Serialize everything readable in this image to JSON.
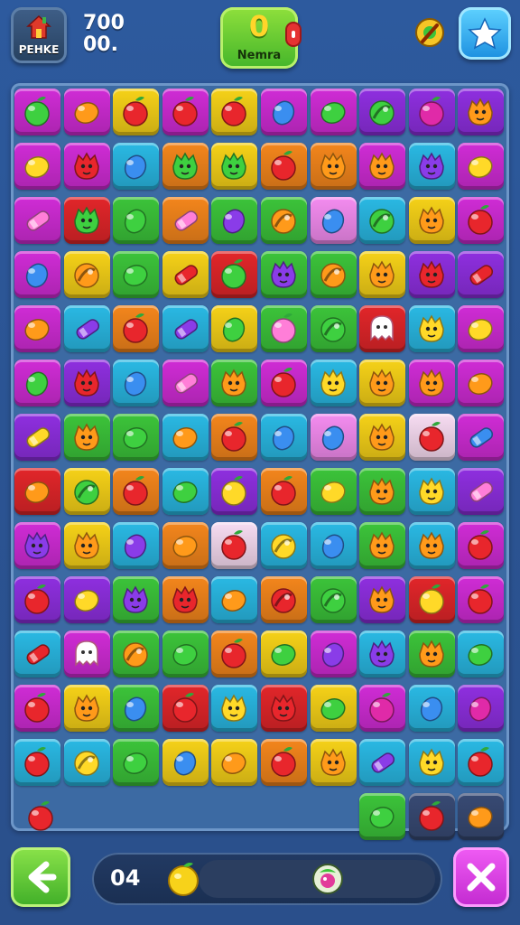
{
  "header": {
    "logo_label": "PEHKE",
    "stat_1": "700",
    "stat_2": "00.",
    "center_value": "0",
    "center_label": "Nemra"
  },
  "footer": {
    "moves": "04"
  },
  "colors": {
    "M": "#d02cd6",
    "Y": "#f6d218",
    "R": "#e2262a",
    "P": "#8f2fe0",
    "C": "#2ab9e4",
    "O": "#f4861c",
    "G": "#3cc43a",
    "L": "#f48cf0",
    "W": "#f7dcf2",
    "D": "#384a74"
  },
  "board": {
    "rows": [
      [
        "M:apple:green",
        "M:lemon:orange",
        "Y:apple:red",
        "M:apple:red",
        "Y:apple:red",
        "M:plum:blue",
        "M:lemon:green",
        "P:bug:green",
        "P:apple:magenta",
        "P:face:orange"
      ],
      [
        "M:lemon:yellow",
        "M:face:red",
        "C:plum:blue",
        "O:face:green",
        "Y:face:green",
        "O:apple:red",
        "O:face:orange",
        "M:face:orange",
        "C:face:purple",
        "M:lemon:yellow"
      ],
      [
        "M:candy:pink",
        "R:face:green",
        "G:plum:green",
        "O:candy:pink",
        "G:plum:purple",
        "G:bug:orange",
        "L:plum:blue",
        "C:bug:green",
        "Y:face:orange",
        "M:apple:red"
      ],
      [
        "M:plum:blue",
        "Y:bug:orange",
        "G:lemon:green",
        "Y:candy:red",
        "R:apple:green",
        "G:face:purple",
        "G:bug:orange",
        "Y:face:orange",
        "P:face:red",
        "P:candy:red"
      ],
      [
        "M:lemon:orange",
        "C:candy:purple",
        "O:apple:red",
        "C:candy:purple",
        "Y:plum:green",
        "G:apple:pink",
        "G:bug:green",
        "R:ghost:white",
        "C:face:yellow",
        "M:lemon:yellow"
      ],
      [
        "M:plum:green",
        "P:face:red",
        "C:plum:blue",
        "M:candy:pink",
        "G:face:orange",
        "M:apple:red",
        "C:face:yellow",
        "Y:face:orange",
        "M:face:orange",
        "M:lemon:orange"
      ],
      [
        "P:candy:yellow",
        "G:face:orange",
        "G:lemon:green",
        "C:lemon:orange",
        "O:apple:red",
        "C:plum:blue",
        "L:plum:blue",
        "Y:face:orange",
        "W:apple:red",
        "M:candy:blue"
      ],
      [
        "R:lemon:orange",
        "Y:bug:green",
        "O:apple:red",
        "C:lemon:green",
        "P:apple:yellow",
        "O:apple:red",
        "G:lemon:yellow",
        "G:face:orange",
        "C:face:yellow",
        "P:candy:pink"
      ],
      [
        "M:face:purple",
        "Y:face:orange",
        "C:plum:purple",
        "O:lemon:orange",
        "W:apple:red",
        "C:bug:yellow",
        "C:plum:blue",
        "G:face:orange",
        "C:face:orange",
        "M:apple:red"
      ],
      [
        "P:apple:red",
        "P:lemon:yellow",
        "G:face:purple",
        "O:face:red",
        "C:lemon:orange",
        "O:bug:red",
        "G:bug:green",
        "P:face:orange",
        "R:apple:yellow",
        "M:apple:red"
      ],
      [
        "C:candy:red",
        "M:ghost:white",
        "G:bug:orange",
        "G:lemon:green",
        "O:apple:red",
        "Y:lemon:green",
        "M:plum:purple",
        "C:face:purple",
        "G:face:orange",
        "C:lemon:green"
      ],
      [
        "M:apple:red",
        "Y:face:orange",
        "G:plum:blue",
        "R:apple:red",
        "C:face:yellow",
        "R:face:red",
        "Y:lemon:green",
        "M:apple:magenta",
        "C:plum:blue",
        "P:plum:magenta"
      ],
      [
        "C:apple:red",
        "C:bug:yellow",
        "G:lemon:green",
        "Y:plum:blue",
        "Y:lemon:orange",
        "O:apple:red",
        "Y:face:orange",
        "C:candy:purple",
        "C:face:yellow",
        "C:apple:red"
      ],
      [
        "-",
        "-",
        "-",
        "-",
        "-",
        "-",
        "-",
        "G:lemon:green",
        "D:apple:red",
        "D:lemon:orange"
      ]
    ],
    "loose_piece": "apple:red"
  }
}
